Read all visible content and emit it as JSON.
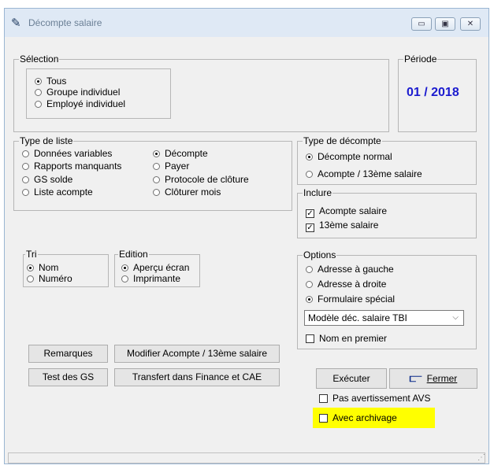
{
  "window": {
    "title": "Décompte salaire",
    "controls": {
      "minimize": "▭",
      "maximize": "▣",
      "close": "✕"
    }
  },
  "selection": {
    "title": "Sélection",
    "options": [
      "Tous",
      "Groupe individuel",
      "Employé individuel"
    ],
    "selected": 0
  },
  "periode": {
    "title": "Période",
    "value": "01 / 2018"
  },
  "type_liste": {
    "title": "Type de liste",
    "options": [
      "Données variables",
      "Rapports manquants",
      "GS solde",
      "Liste acompte",
      "Décompte",
      "Payer",
      "Protocole de clôture",
      "Clôturer mois"
    ],
    "selected": 4
  },
  "type_decompte": {
    "title": "Type de décompte",
    "options": [
      "Décompte normal",
      "Acompte / 13ème salaire"
    ],
    "selected": 0
  },
  "inclure": {
    "title": "Inclure",
    "items": [
      {
        "label": "Acompte salaire",
        "checked": true
      },
      {
        "label": "13ème salaire",
        "checked": true
      }
    ]
  },
  "tri": {
    "title": "Tri",
    "options": [
      "Nom",
      "Numéro"
    ],
    "selected": 0
  },
  "edition": {
    "title": "Edition",
    "options": [
      "Aperçu écran",
      "Imprimante"
    ],
    "selected": 0
  },
  "options": {
    "title": "Options",
    "radios": [
      "Adresse à gauche",
      "Adresse à droite",
      "Formulaire spécial"
    ],
    "selected": 2,
    "dropdown_value": "Modèle déc. salaire TBI",
    "nom_en_premier": {
      "label": "Nom en premier",
      "checked": false
    }
  },
  "buttons": {
    "remarques": "Remarques",
    "modifier": "Modifier Acompte / 13ème salaire",
    "test_gs": "Test des GS",
    "transfert": "Transfert dans Finance et CAE",
    "executer": "Exécuter",
    "fermer": "Fermer"
  },
  "checks_bottom": {
    "pas_avertissement": {
      "label": "Pas avertissement AVS",
      "checked": false
    },
    "avec_archivage": {
      "label": "Avec archivage",
      "checked": false,
      "highlight": "#ffff00"
    }
  },
  "colors": {
    "accent": "#1b1bcf",
    "titlebar": "#dfe9f5"
  }
}
